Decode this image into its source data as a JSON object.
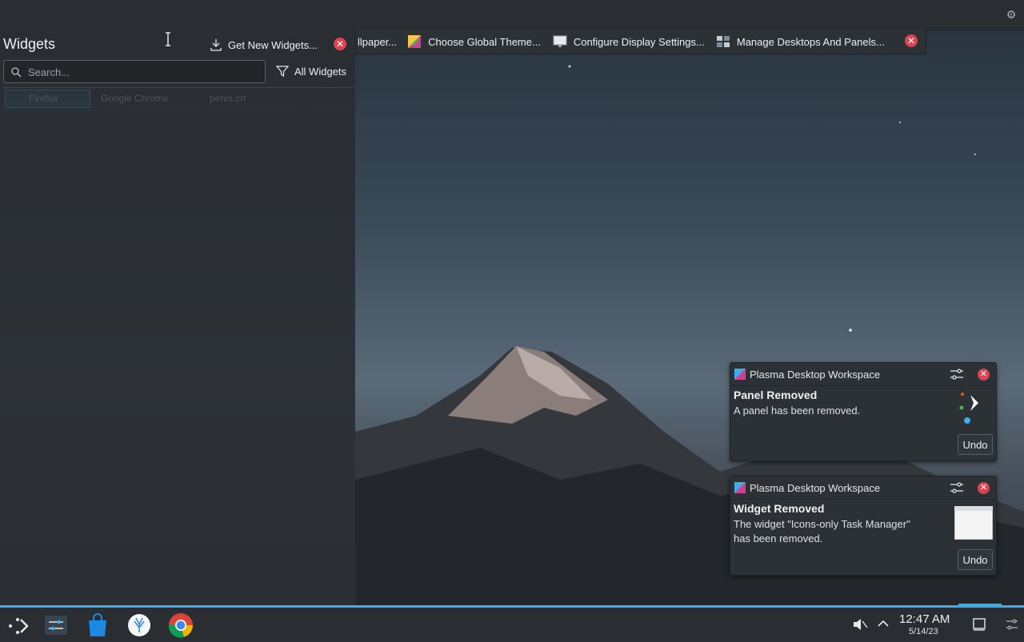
{
  "toolbar": {
    "items": [
      {
        "label": "llpaper...",
        "icon": "wallpaper-icon"
      },
      {
        "label": "Choose Global Theme...",
        "icon": "theme-icon"
      },
      {
        "label": "Configure Display Settings...",
        "icon": "display-icon"
      },
      {
        "label": "Manage Desktops And Panels...",
        "icon": "desktops-icon"
      }
    ],
    "close_icon": "close-icon"
  },
  "widgets": {
    "title": "Widgets",
    "get_new_label": "Get New Widgets...",
    "search_placeholder": "Search...",
    "filter_label": "All Widgets",
    "faded_items": [
      "Firefox",
      "Google Chrome",
      "penis.crt"
    ]
  },
  "notifications": [
    {
      "app": "Plasma Desktop Workspace",
      "title": "Panel Removed",
      "body": "A panel has been removed.",
      "action": "Undo"
    },
    {
      "app": "Plasma Desktop Workspace",
      "title": "Widget Removed",
      "body": "The widget \"Icons-only Task Manager\" has been removed.",
      "action": "Undo"
    }
  ],
  "taskbar": {
    "apps": [
      "application-launcher-icon",
      "system-settings-icon",
      "discover-store-icon",
      "kde-connect-icon",
      "google-chrome-icon"
    ],
    "tray": [
      "muted-volume-icon",
      "tray-expand-icon"
    ],
    "time": "12:47 AM",
    "date": "5/14/23"
  },
  "colors": {
    "accent": "#3daee9",
    "close": "#da4453",
    "panel": "#2a2e32"
  }
}
